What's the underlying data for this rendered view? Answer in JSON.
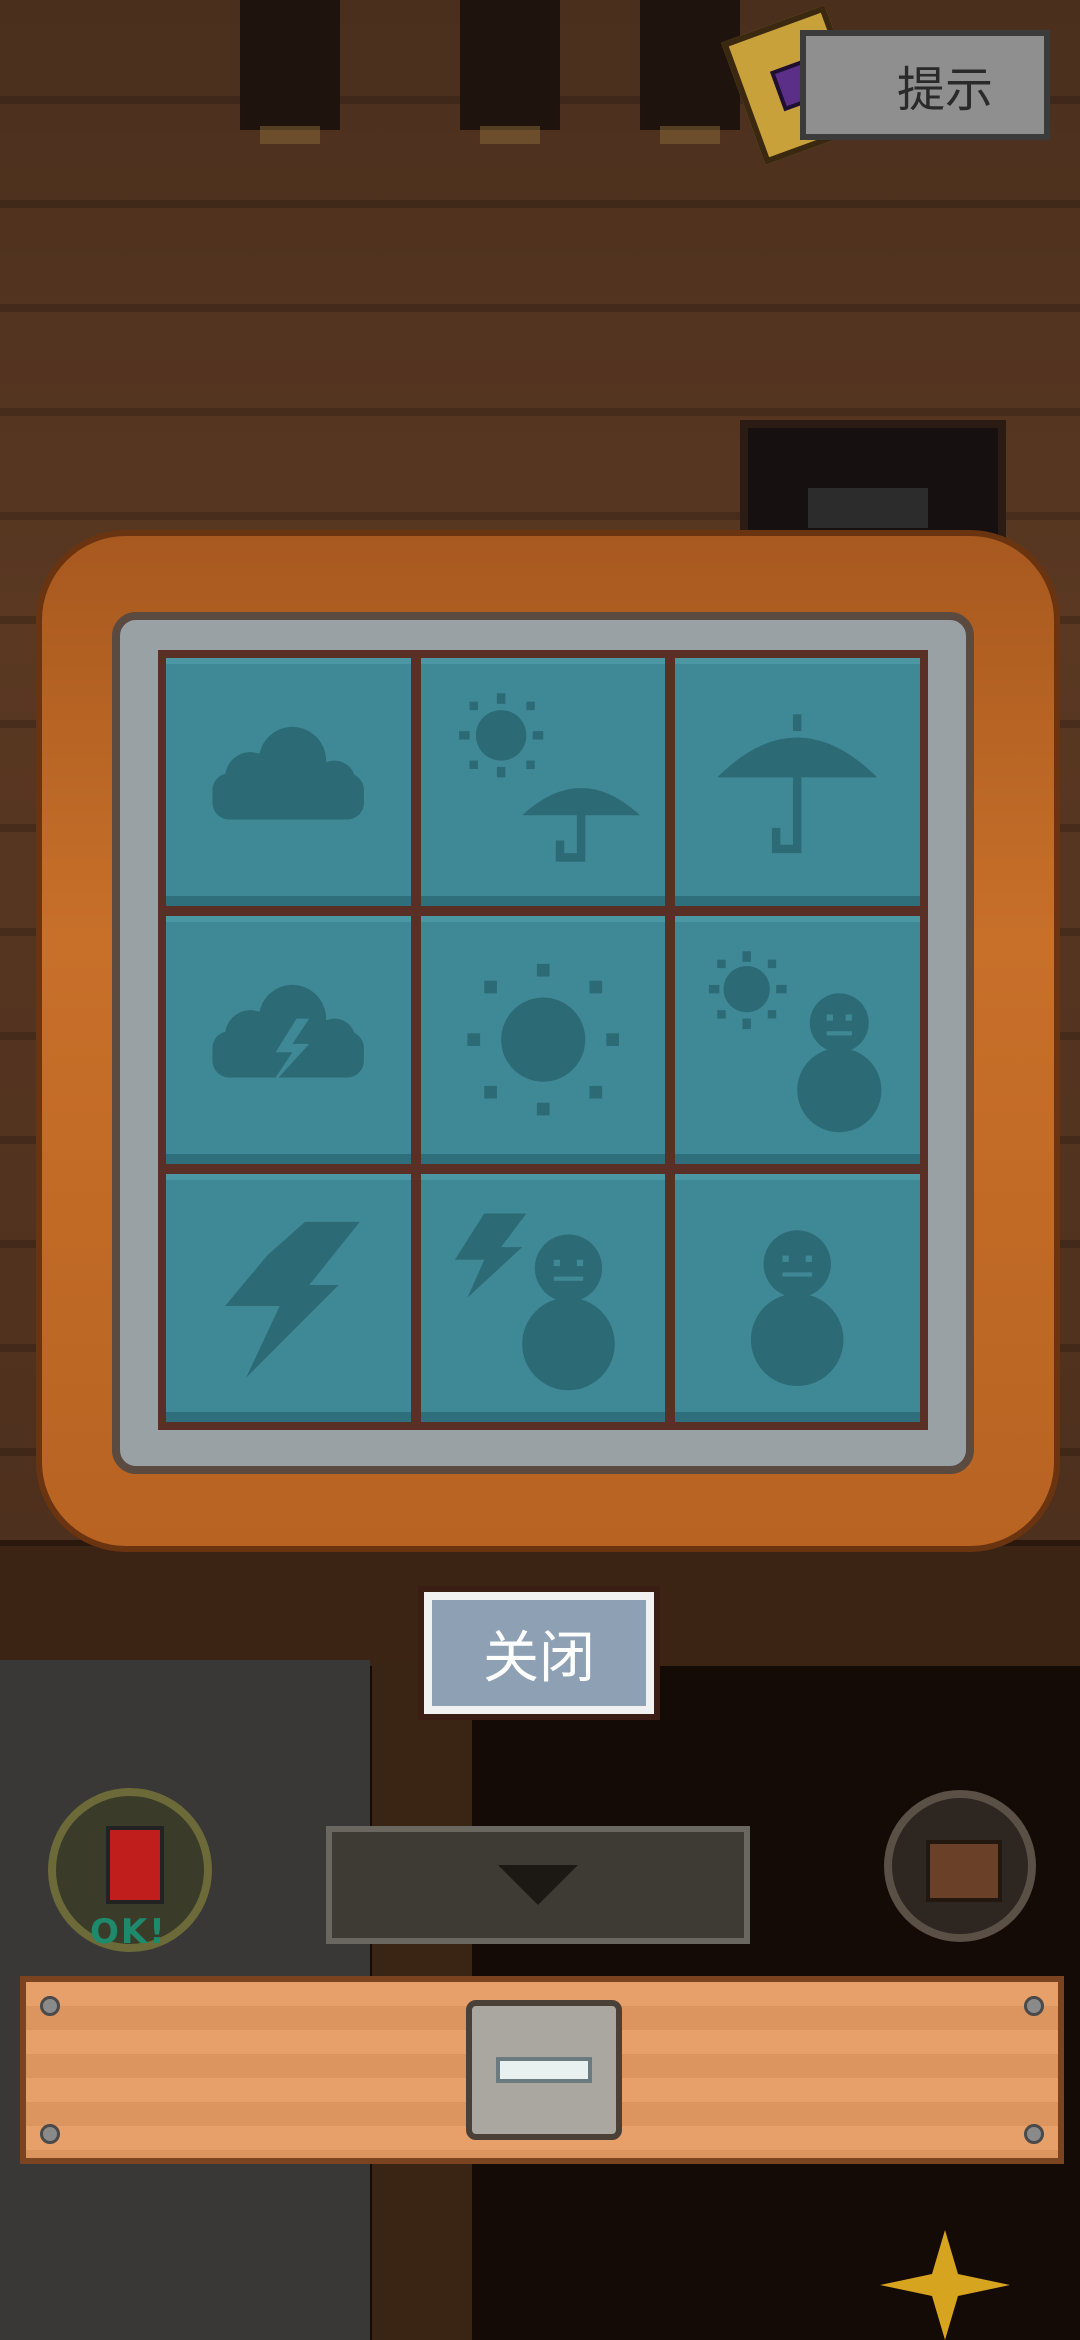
{
  "hint": {
    "label": "提示"
  },
  "puzzle": {
    "tiles": [
      {
        "row": 1,
        "col": 1,
        "icon": "cloud-icon"
      },
      {
        "row": 1,
        "col": 2,
        "icon": "sun-umbrella-icon"
      },
      {
        "row": 1,
        "col": 3,
        "icon": "umbrella-icon"
      },
      {
        "row": 2,
        "col": 1,
        "icon": "storm-cloud-icon"
      },
      {
        "row": 2,
        "col": 2,
        "icon": "sun-icon"
      },
      {
        "row": 2,
        "col": 3,
        "icon": "sun-snowman-icon"
      },
      {
        "row": 3,
        "col": 1,
        "icon": "lightning-icon"
      },
      {
        "row": 3,
        "col": 2,
        "icon": "lightning-snowman-icon"
      },
      {
        "row": 3,
        "col": 3,
        "icon": "snowman-icon"
      }
    ]
  },
  "close": {
    "label": "关闭"
  },
  "lantern": {
    "status": "OK!"
  },
  "colors": {
    "tile": "#3f8895",
    "glyph": "#2c6a76",
    "wood": "#c8702a"
  }
}
